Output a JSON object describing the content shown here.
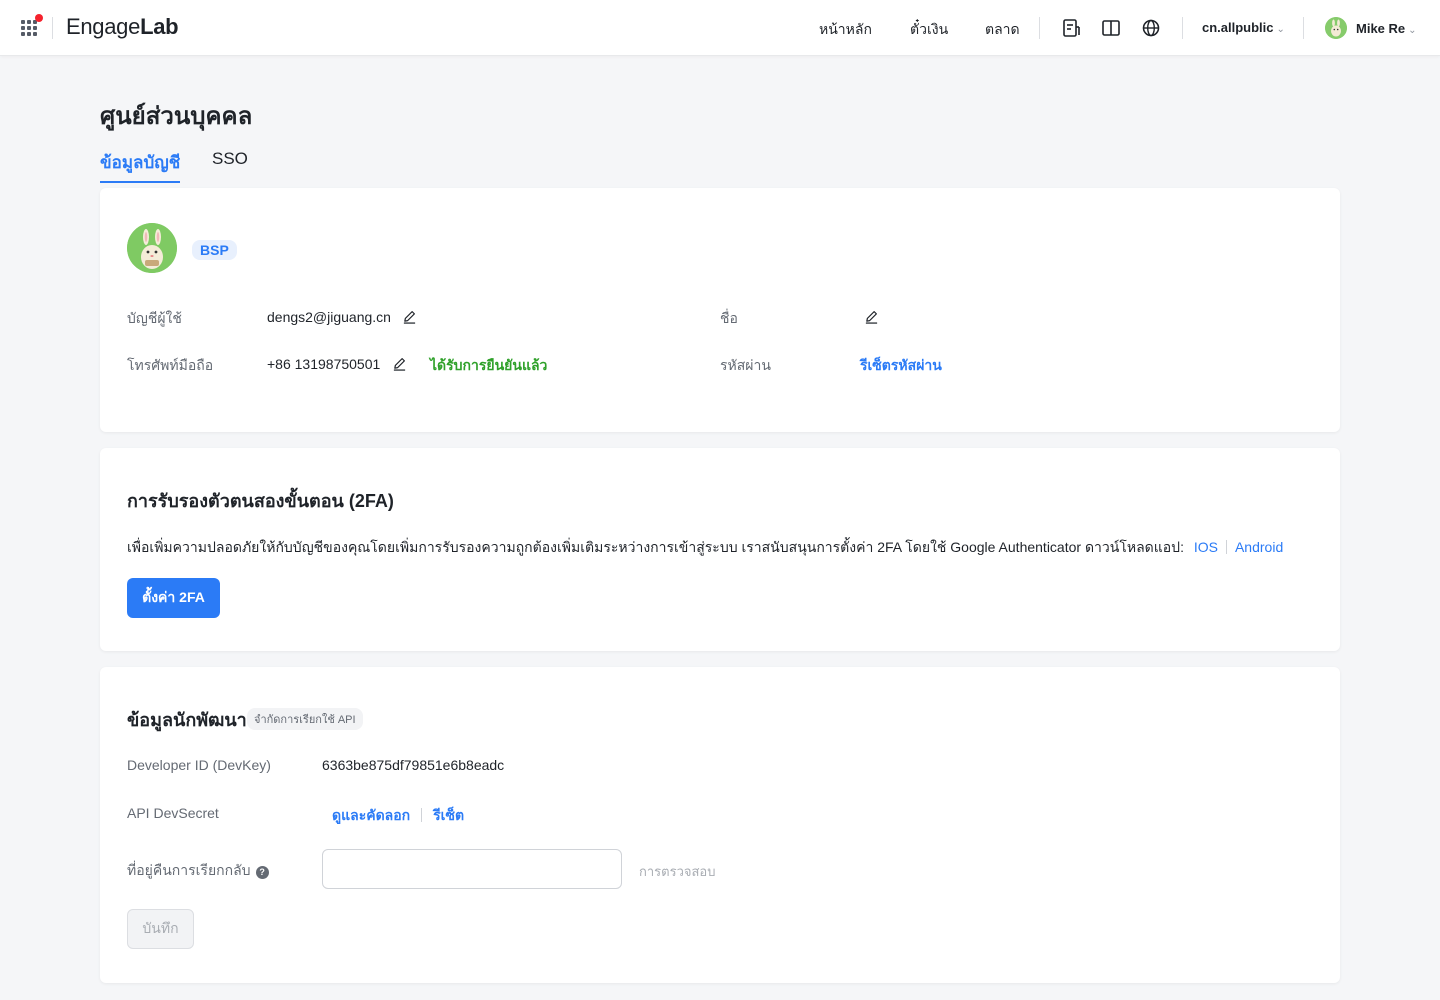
{
  "topbar": {
    "logo_pre": "Engage",
    "logo_post": "Lab",
    "nav": [
      "หน้าหลัก",
      "ตั๋วเงิน",
      "ตลาด"
    ],
    "account": "cn.allpublic",
    "user_name": "Mike Re",
    "icons": [
      "apps-grid-icon",
      "document-icon",
      "book-icon",
      "globe-icon",
      "chevron-down-icon"
    ]
  },
  "page": {
    "title": "ศูนย์ส่วนบุคคล",
    "tabs": [
      {
        "label": "ข้อมูลบัญชี",
        "active": true
      },
      {
        "label": "SSO",
        "active": false
      }
    ]
  },
  "profile": {
    "tag": "BSP",
    "account_label": "บัญชีผู้ใช้",
    "account_value": "dengs2@jiguang.cn",
    "name_label": "ชื่อ",
    "name_value": "",
    "phone_label": "โทรศัพท์มือถือ",
    "phone_value": "+86 13198750501",
    "phone_status": "ได้รับการยืนยันแล้ว",
    "password_label": "รหัสผ่าน",
    "password_action": "รีเซ็ตรหัสผ่าน"
  },
  "twofa": {
    "title": "การรับรองตัวตนสองขั้นตอน (2FA)",
    "description": "เพื่อเพิ่มความปลอดภัยให้กับบัญชีของคุณโดยเพิ่มการรับรองความถูกต้องเพิ่มเติมระหว่างการเข้าสู่ระบบ เราสนับสนุนการตั้งค่า 2FA โดยใช้ Google Authenticator ดาวน์โหลดแอป:",
    "ios_link": "IOS",
    "android_link": "Android",
    "button": "ตั้งค่า 2FA"
  },
  "developer": {
    "title": "ข้อมูลนักพัฒนา",
    "limit_tag": "จำกัดการเรียกใช้ API",
    "devkey_label": "Developer ID (DevKey)",
    "devkey_value": "6363be875df79851e6b8eadc",
    "secret_label": "API DevSecret",
    "secret_view": "ดูและคัดลอก",
    "secret_reset": "รีเซ็ต",
    "callback_label": "ที่อยู่คืนการเรียกกลับ",
    "callback_value": "",
    "verify": "การตรวจสอบ",
    "save": "บันทึก"
  },
  "colors": {
    "accent": "#2b7bf6",
    "verified": "#2fa12a",
    "background": "#f5f6f8"
  }
}
